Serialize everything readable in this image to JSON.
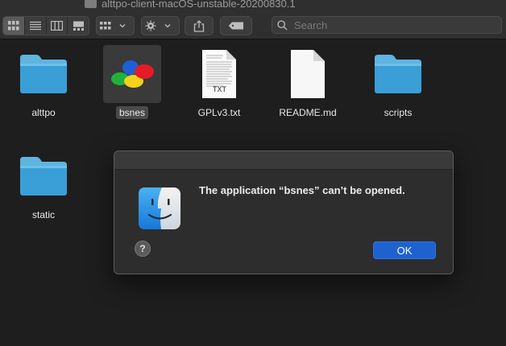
{
  "window": {
    "title": "alttpo-client-macOS-unstable-20200830.1"
  },
  "toolbar": {
    "view_modes": [
      "icon-view",
      "list-view",
      "column-view",
      "gallery-view"
    ],
    "active_view": "icon-view",
    "search_placeholder": "Search"
  },
  "files": [
    {
      "name": "alttpo",
      "kind": "folder",
      "selected": false
    },
    {
      "name": "bsnes",
      "kind": "application",
      "selected": true
    },
    {
      "name": "GPLv3.txt",
      "kind": "text",
      "badge": "TXT",
      "selected": false
    },
    {
      "name": "README.md",
      "kind": "document",
      "selected": false
    },
    {
      "name": "scripts",
      "kind": "folder",
      "selected": false
    },
    {
      "name": "static",
      "kind": "folder",
      "selected": false
    }
  ],
  "dialog": {
    "message": "The application “bsnes” can’t be opened.",
    "help_label": "?",
    "ok_label": "OK"
  },
  "colors": {
    "folder_top": "#5fb4e0",
    "folder_body": "#3a9fd6",
    "accent_button": "#1e62d0"
  }
}
